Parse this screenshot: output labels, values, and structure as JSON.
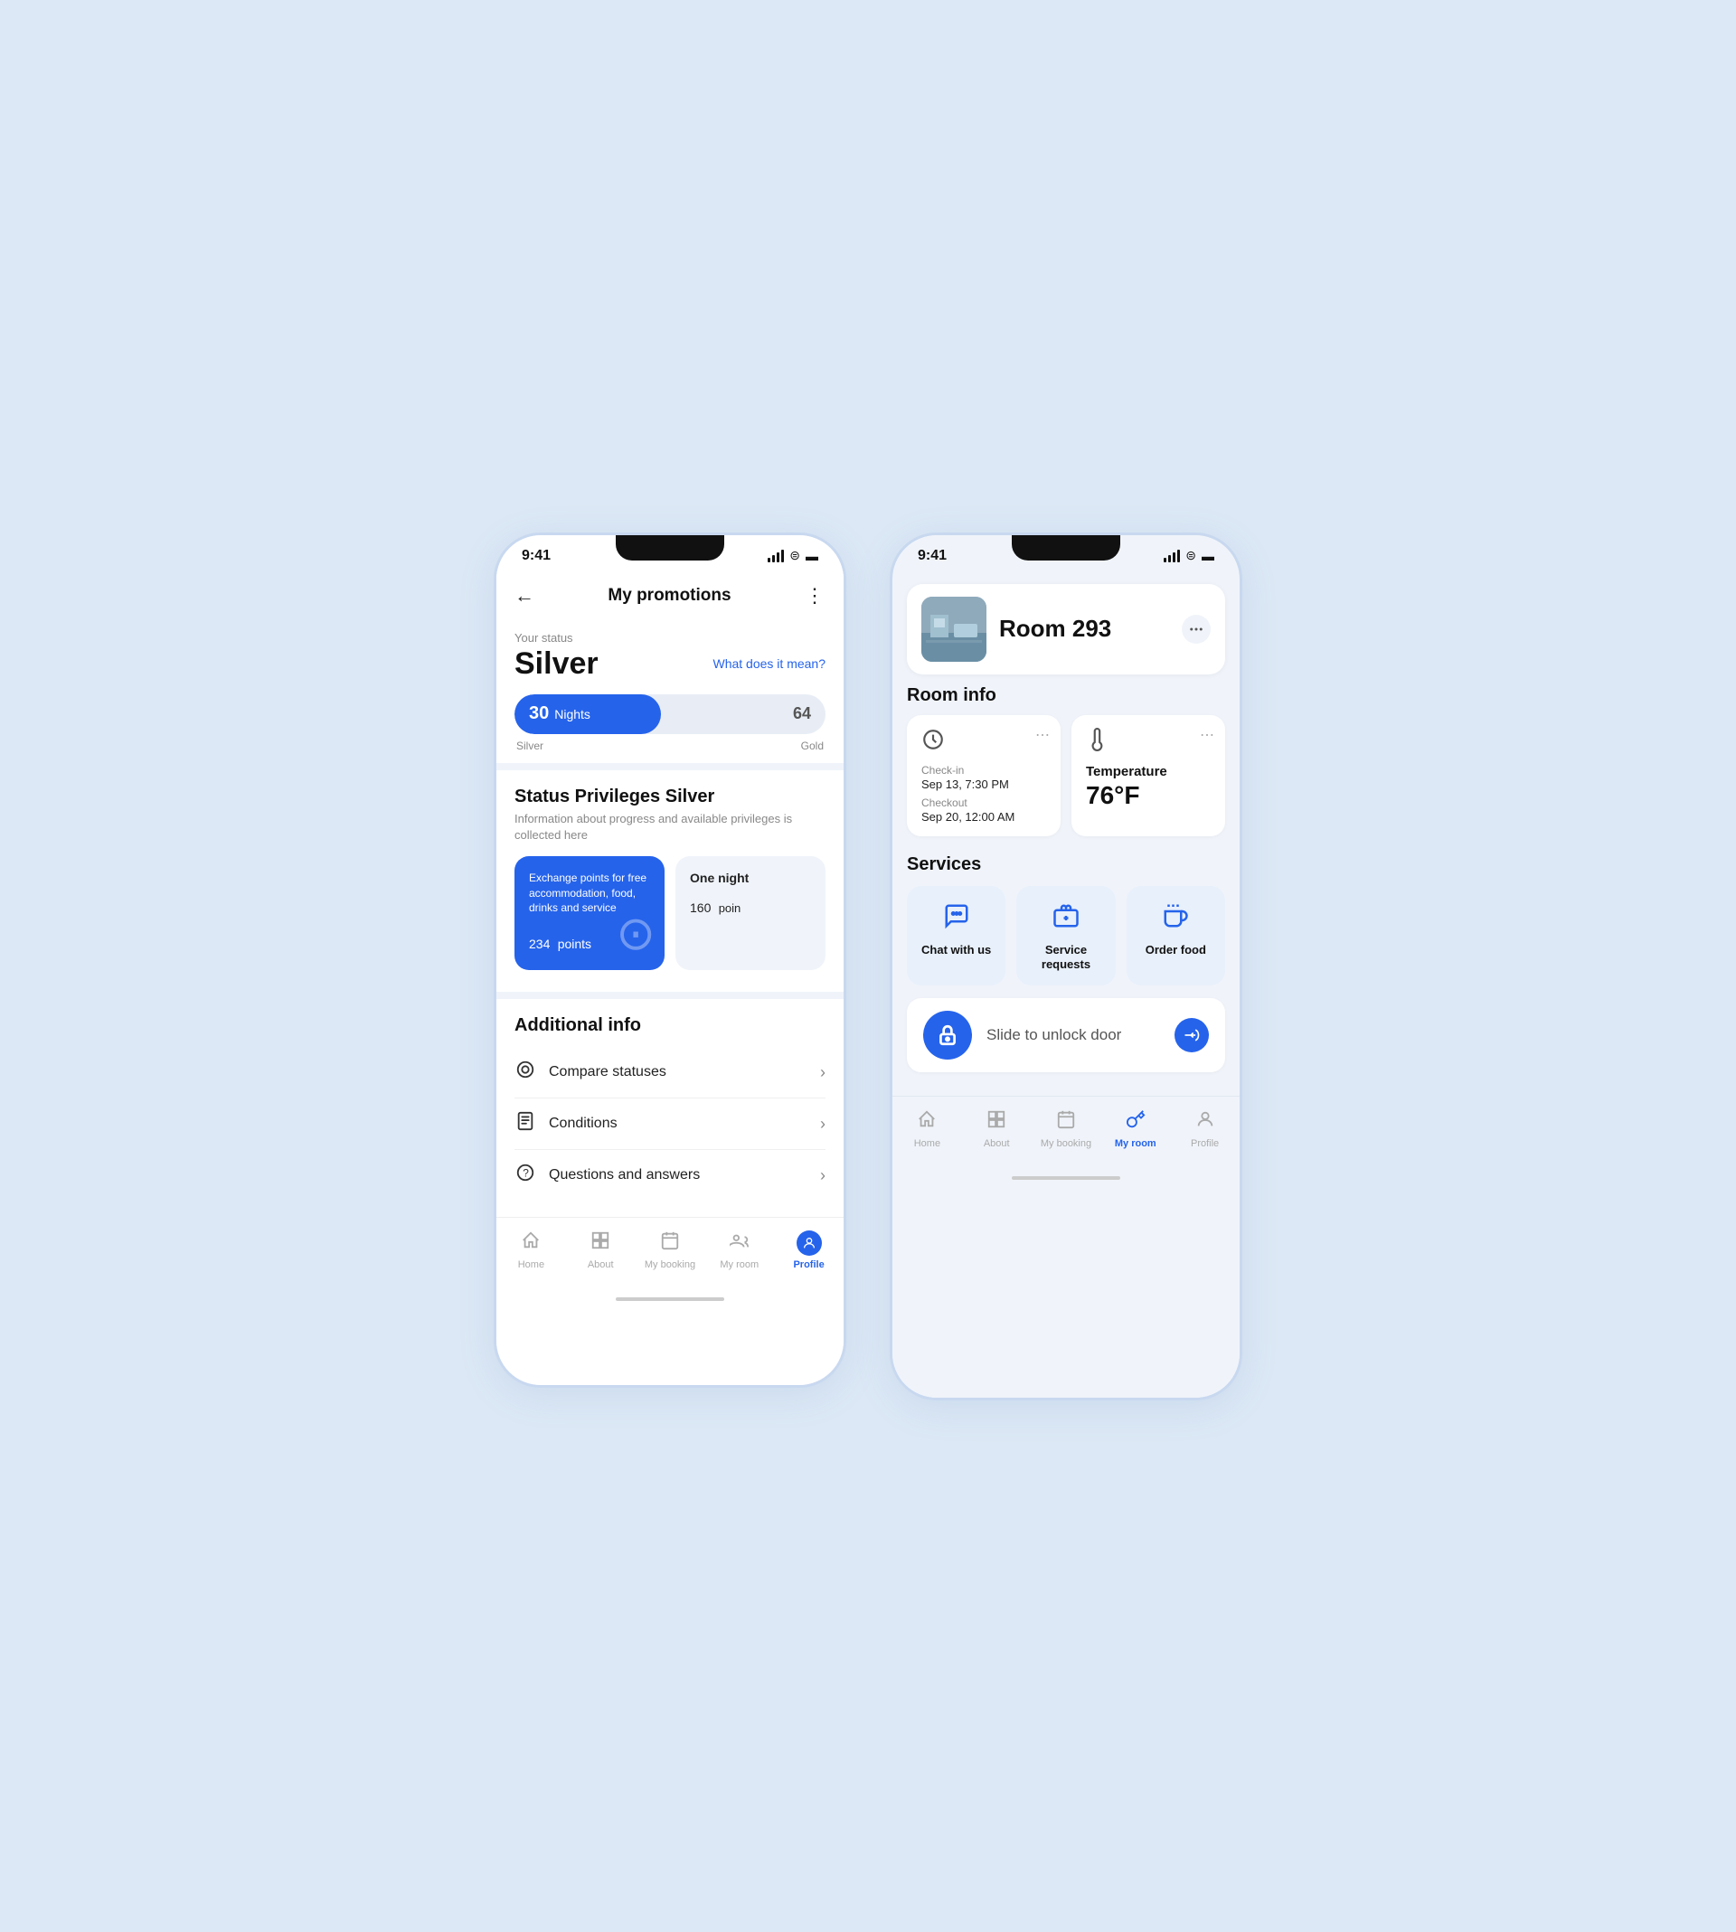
{
  "app": {
    "time": "9:41",
    "accent_color": "#2563eb",
    "bg_color": "#dce8f5"
  },
  "phone1": {
    "header": {
      "title": "My promotions",
      "back_label": "←",
      "more_label": "⋮"
    },
    "status": {
      "label": "Your status",
      "value": "Silver",
      "what_link": "What does it mean?"
    },
    "progress": {
      "current_nights": "30",
      "nights_label": "Nights",
      "max": "64",
      "start_label": "Silver",
      "end_label": "Gold"
    },
    "privileges": {
      "title": "Status Privileges Silver",
      "desc": "Information about progress and available privileges is collected here"
    },
    "cards": [
      {
        "type": "blue",
        "desc": "Exchange points for free accommodation, food, drinks and service",
        "points": "234",
        "points_label": "points"
      },
      {
        "type": "gray",
        "title": "One night",
        "points": "160",
        "points_label": "poin"
      }
    ],
    "additional": {
      "title": "Additional info",
      "items": [
        {
          "icon": "⊙",
          "label": "Compare statuses"
        },
        {
          "icon": "📄",
          "label": "Conditions"
        },
        {
          "icon": "?",
          "label": "Questions and answers"
        }
      ]
    },
    "nav": [
      {
        "label": "Home",
        "icon": "⌂",
        "active": false
      },
      {
        "label": "About",
        "icon": "▦",
        "active": false
      },
      {
        "label": "My booking",
        "icon": "📅",
        "active": false
      },
      {
        "label": "My room",
        "icon": "🔑",
        "active": false
      },
      {
        "label": "Profile",
        "icon": "👤",
        "active": true
      }
    ]
  },
  "phone2": {
    "room": {
      "name": "Room 293",
      "more_label": "⋯"
    },
    "room_info": {
      "title": "Room info",
      "checkin_label": "Check-in",
      "checkin_value": "Sep 13, 7:30 PM",
      "checkout_label": "Checkout",
      "checkout_value": "Sep 20, 12:00 AM",
      "temp_label": "Temperature",
      "temp_value": "76°F"
    },
    "services": {
      "title": "Services",
      "items": [
        {
          "label": "Chat with us",
          "icon": "💬"
        },
        {
          "label": "Service requests",
          "icon": "🧳"
        },
        {
          "label": "Order food",
          "icon": "☕"
        }
      ]
    },
    "unlock": {
      "text": "Slide to unlock door",
      "lock_icon": "🔒",
      "thumb_icon": "👍"
    },
    "nav": [
      {
        "label": "Home",
        "icon": "⌂",
        "active": false
      },
      {
        "label": "About",
        "icon": "▦",
        "active": false
      },
      {
        "label": "My booking",
        "icon": "📅",
        "active": false
      },
      {
        "label": "My room",
        "icon": "🔑",
        "active": true
      },
      {
        "label": "Profile",
        "icon": "👤",
        "active": false
      }
    ]
  }
}
